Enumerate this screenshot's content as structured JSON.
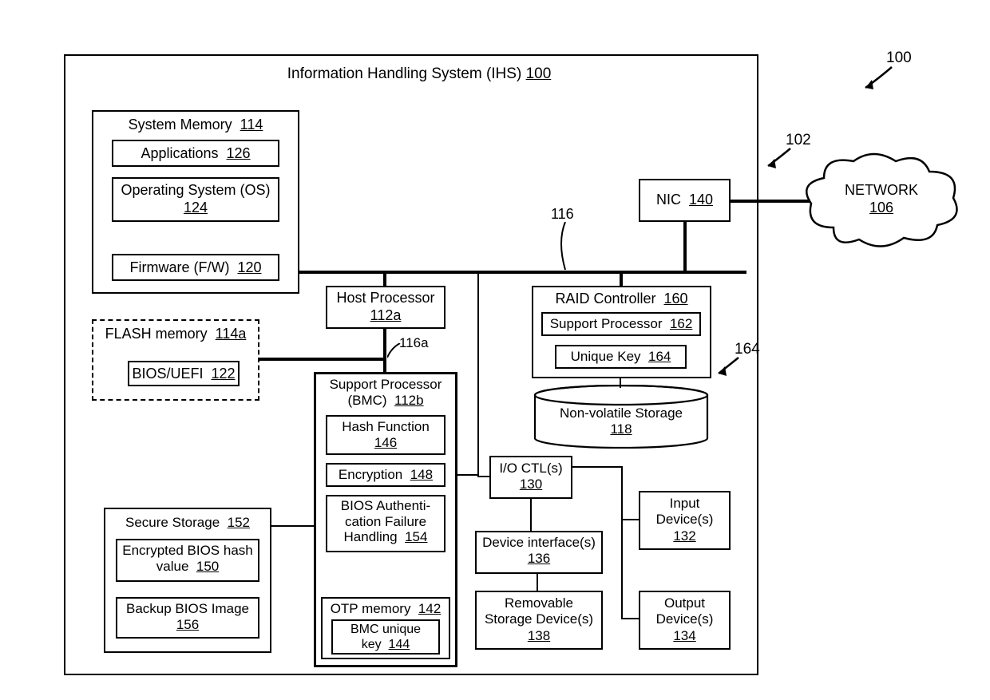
{
  "caption": {
    "ihs_title": "Information Handling System (IHS)",
    "ihs_ref": "100"
  },
  "refs": {
    "r100": "100",
    "r102": "102",
    "r116": "116",
    "r116a": "116a",
    "r164": "164"
  },
  "sysmem": {
    "title": "System Memory",
    "ref": "114",
    "apps": "Applications",
    "apps_ref": "126",
    "os": "Operating System (OS)",
    "os_ref": "124",
    "fw": "Firmware (F/W)",
    "fw_ref": "120"
  },
  "flash": {
    "title": "FLASH memory",
    "ref": "114a",
    "bios": "BIOS/UEFI",
    "bios_ref": "122"
  },
  "hostproc": {
    "title": "Host Processor",
    "ref": "112a"
  },
  "bmc": {
    "title": "Support Processor (BMC)",
    "ref": "112b",
    "hash": "Hash Function",
    "hash_ref": "146",
    "enc": "Encryption",
    "enc_ref": "148",
    "bafh": "BIOS Authentication Failure Handling",
    "bafh_ref": "154",
    "otp": "OTP memory",
    "otp_ref": "142",
    "key": "BMC unique key",
    "key_ref": "144"
  },
  "secure": {
    "title": "Secure Storage",
    "ref": "152",
    "hash": "Encrypted BIOS hash value",
    "hash_ref": "150",
    "backup": "Backup BIOS Image",
    "backup_ref": "156"
  },
  "raid": {
    "title": "RAID Controller",
    "ref": "160",
    "sp": "Support Processor",
    "sp_ref": "162",
    "uk": "Unique Key",
    "uk_ref": "164"
  },
  "nvs": {
    "title": "Non-volatile Storage",
    "ref": "118"
  },
  "ioctl": {
    "title": "I/O CTL(s)",
    "ref": "130"
  },
  "devif": {
    "title": "Device interface(s)",
    "ref": "136"
  },
  "remov": {
    "title": "Removable Storage Device(s)",
    "ref": "138"
  },
  "input": {
    "title": "Input Device(s)",
    "ref": "132"
  },
  "output": {
    "title": "Output Device(s)",
    "ref": "134"
  },
  "nic": {
    "title": "NIC",
    "ref": "140"
  },
  "network": {
    "title": "NETWORK",
    "ref": "106"
  }
}
